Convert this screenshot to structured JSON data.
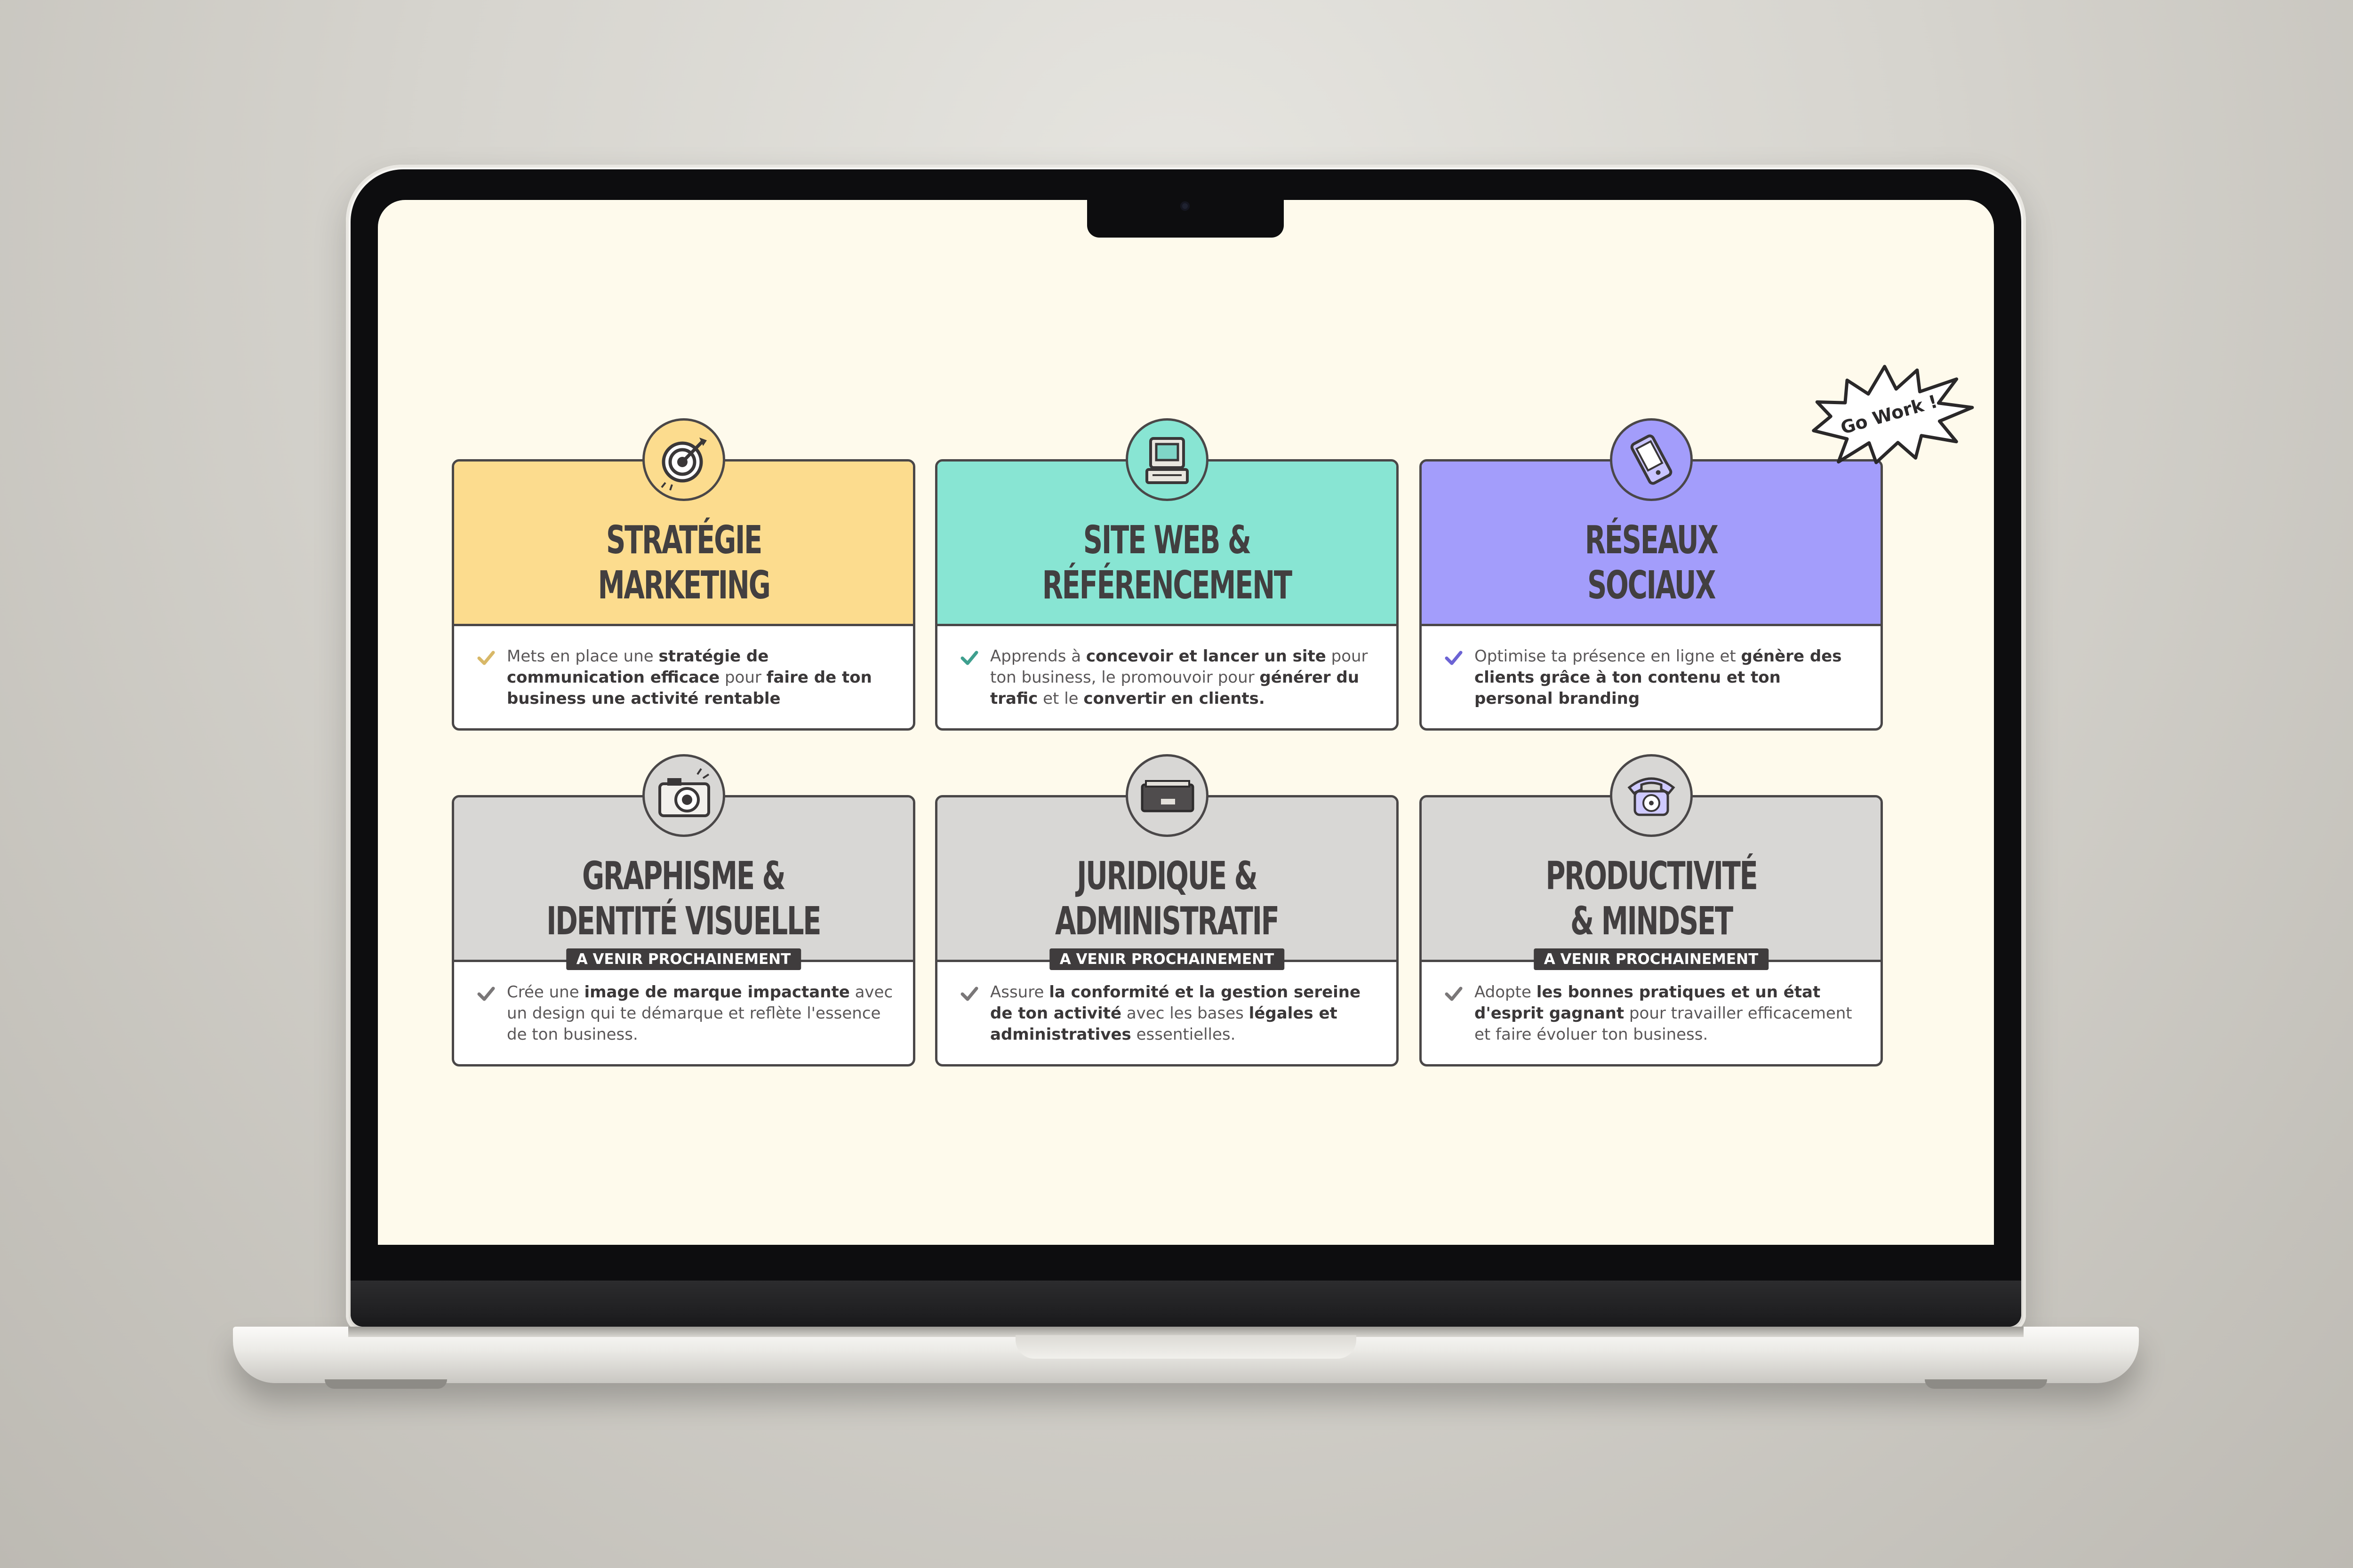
{
  "cards": [
    {
      "title_line1": "STRATÉGIE",
      "title_line2": "MARKETING",
      "icon": "target-icon",
      "color": "#fcdc8e",
      "check_color": "#d8b868",
      "soon_label": "",
      "text": [
        {
          "t": "Mets en place une ",
          "b": false
        },
        {
          "t": "stratégie de communication efficace",
          "b": true
        },
        {
          "t": " pour ",
          "b": false
        },
        {
          "t": "faire de ton business une activité rentable",
          "b": true
        }
      ]
    },
    {
      "title_line1": "SITE WEB &",
      "title_line2": "RÉFÉRENCEMENT",
      "icon": "computer-icon",
      "color": "#88e5d3",
      "check_color": "#3e9f8e",
      "soon_label": "",
      "text": [
        {
          "t": "Apprends à ",
          "b": false
        },
        {
          "t": "concevoir et lancer un site",
          "b": true
        },
        {
          "t": " pour ton business, le promouvoir pour ",
          "b": false
        },
        {
          "t": "générer du trafic",
          "b": true
        },
        {
          "t": " et le ",
          "b": false
        },
        {
          "t": "convertir en clients.",
          "b": true
        }
      ]
    },
    {
      "title_line1": "RÉSEAUX",
      "title_line2": "SOCIAUX",
      "icon": "phone-icon",
      "color": "#a39dfb",
      "check_color": "#6c63d4",
      "soon_label": "",
      "text": [
        {
          "t": "Optimise ta présence en ligne et ",
          "b": false
        },
        {
          "t": "génère des clients grâce à ton contenu et ton personal branding",
          "b": true
        }
      ]
    },
    {
      "title_line1": "GRAPHISME &",
      "title_line2": "IDENTITÉ VISUELLE",
      "icon": "camera-icon",
      "color": "#d8d7d5",
      "check_color": "#7a7778",
      "soon_label": "A VENIR PROCHAINEMENT",
      "text": [
        {
          "t": "Crée une ",
          "b": false
        },
        {
          "t": "image de marque impactante",
          "b": true
        },
        {
          "t": " avec un design qui te démarque et reflète l'essence de ton business.",
          "b": false
        }
      ]
    },
    {
      "title_line1": "JURIDIQUE &",
      "title_line2": "ADMINISTRATIF",
      "icon": "drawer-icon",
      "color": "#d8d7d5",
      "check_color": "#7a7778",
      "soon_label": "A VENIR PROCHAINEMENT",
      "text": [
        {
          "t": "Assure ",
          "b": false
        },
        {
          "t": "la conformité et la gestion sereine de ton activité",
          "b": true
        },
        {
          "t": " avec les bases ",
          "b": false
        },
        {
          "t": "légales et administratives",
          "b": true
        },
        {
          "t": " essentielles.",
          "b": false
        }
      ]
    },
    {
      "title_line1": "PRODUCTIVITÉ",
      "title_line2": "& MINDSET",
      "icon": "telephone-icon",
      "color": "#d8d7d5",
      "check_color": "#7a7778",
      "soon_label": "A VENIR PROCHAINEMENT",
      "text": [
        {
          "t": "Adopte ",
          "b": false
        },
        {
          "t": "les bonnes pratiques et un état d'esprit gagnant",
          "b": true
        },
        {
          "t": " pour travailler efficacement et faire évoluer ton business.",
          "b": false
        }
      ]
    }
  ],
  "sticker": {
    "label": "Go Work !"
  }
}
